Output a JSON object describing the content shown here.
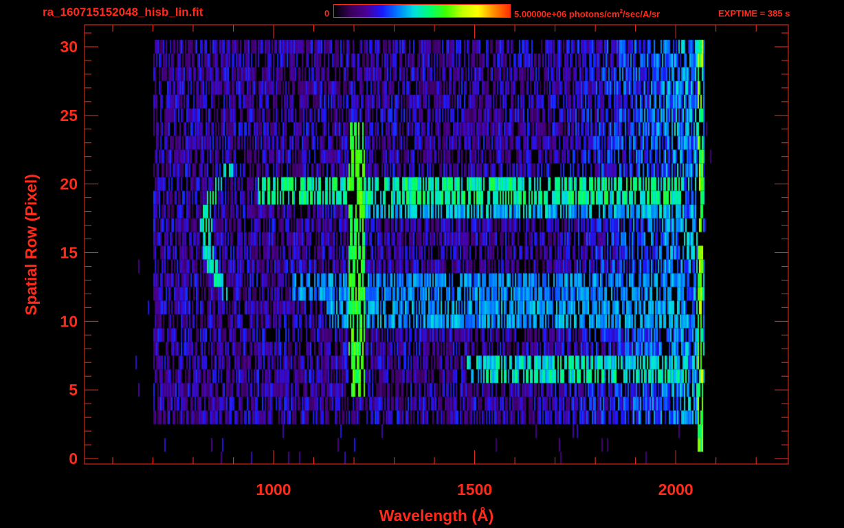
{
  "header": {
    "file_name": "ra_160715152048_hisb_lin.fit",
    "colorbar_min": "0",
    "colorbar_max_value": "5.00000e+06",
    "colorbar_max_units_pre": "photons/cm",
    "colorbar_max_units_sup": "2",
    "colorbar_max_units_post": "/sec/A/sr",
    "exptime": "EXPTIME = 385 s"
  },
  "colors": {
    "annotation": "#ff2a1a",
    "background": "#000000",
    "colormap": [
      "#000000",
      "#3a005a",
      "#4b0096",
      "#1a1aff",
      "#0080ff",
      "#00e0e0",
      "#00ff70",
      "#40ff00",
      "#c0ff00",
      "#ffff00",
      "#ff9000",
      "#ff3000"
    ]
  },
  "chart_data": {
    "type": "heatmap",
    "title": "",
    "xlabel": "Wavelength (Å)",
    "ylabel": "Spatial Row (Pixel)",
    "xlim": [
      530,
      2280
    ],
    "ylim": [
      -0.4,
      31.6
    ],
    "xticks": [
      1000,
      1500,
      2000
    ],
    "xtick_labels": [
      "1000",
      "1500",
      "2000"
    ],
    "yticks": [
      0,
      5,
      10,
      15,
      20,
      25,
      30
    ],
    "ytick_labels": [
      "0",
      "5",
      "10",
      "15",
      "20",
      "25",
      "30"
    ],
    "grid": false,
    "colorbar": {
      "min": 0,
      "max": 5000000,
      "units": "photons/cm²/sec/A/sr"
    },
    "rows": 30,
    "signal_extent": {
      "x_start": 700,
      "x_end": 2070,
      "row_start": 3,
      "row_end": 30
    },
    "features": [
      {
        "name": "bright-vertical-line",
        "x": 1205,
        "row_start": 5,
        "row_end": 24,
        "level": 0.62
      },
      {
        "name": "curved-arc",
        "x_center": 860,
        "row_start": 12,
        "row_end": 21,
        "level": 0.5
      },
      {
        "name": "edge-bright-column",
        "x": 2060,
        "row_start": 1,
        "row_end": 30,
        "level": 0.7
      }
    ],
    "bands": [
      {
        "row": 19.5,
        "x_start": 960,
        "x_end": 2020,
        "level": 0.55
      },
      {
        "row": 18.5,
        "x_start": 1200,
        "x_end": 2020,
        "level": 0.45
      },
      {
        "row": 12.5,
        "x_start": 1040,
        "x_end": 2020,
        "level": 0.4
      },
      {
        "row": 10.5,
        "x_start": 1130,
        "x_end": 2020,
        "level": 0.42
      },
      {
        "row": 6.5,
        "x_start": 1480,
        "x_end": 2030,
        "level": 0.5
      }
    ]
  }
}
